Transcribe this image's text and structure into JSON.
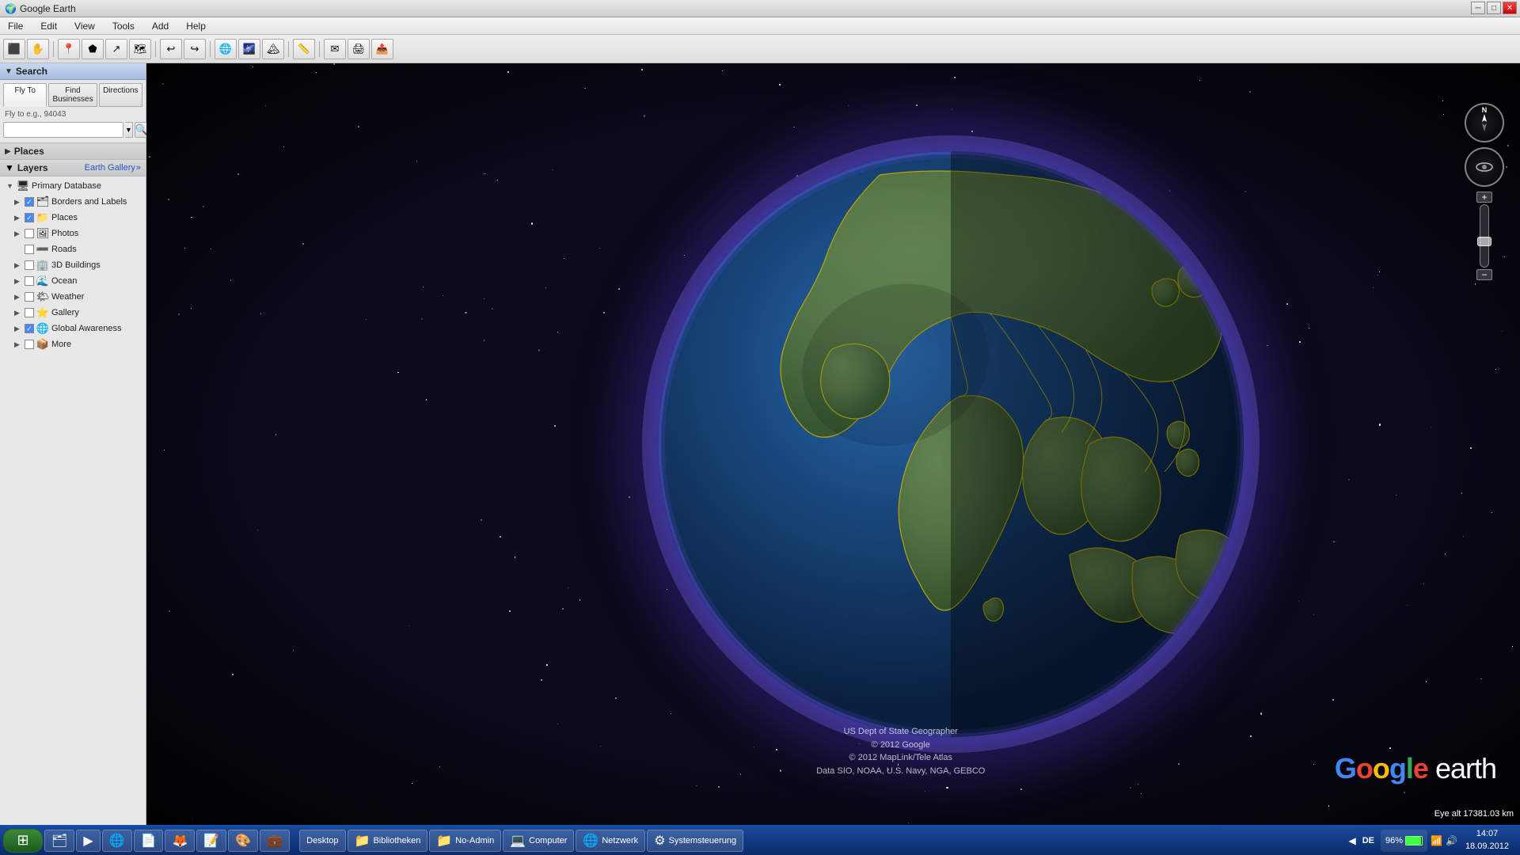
{
  "titlebar": {
    "title": "Google Earth",
    "icon": "🌍",
    "min_label": "─",
    "max_label": "□",
    "close_label": "✕"
  },
  "menubar": {
    "items": [
      "File",
      "Edit",
      "View",
      "Tools",
      "Add",
      "Help"
    ]
  },
  "toolbar": {
    "buttons": [
      "🔲",
      "✋",
      "🔍",
      "🔍",
      "↩",
      "↪",
      "🌐",
      "🖼",
      "🗺",
      "📏",
      "✉",
      "📌",
      "📷"
    ]
  },
  "search": {
    "section_label": "Search",
    "tabs": [
      "Fly To",
      "Find Businesses",
      "Directions"
    ],
    "active_tab": "Fly To",
    "hint": "Fly to e.g., 94043",
    "placeholder": "",
    "go_icon": "🔍"
  },
  "places": {
    "section_label": "Places"
  },
  "layers": {
    "section_label": "Layers",
    "gallery_label": "Earth Gallery",
    "gallery_arrow": "»",
    "items": [
      {
        "id": "primary-db",
        "name": "Primary Database",
        "level": 0,
        "expandable": true,
        "has_cb": false,
        "checked": false,
        "icon": "🖥"
      },
      {
        "id": "borders",
        "name": "Borders and Labels",
        "level": 1,
        "expandable": true,
        "has_cb": true,
        "checked": true,
        "icon": "🗂"
      },
      {
        "id": "places",
        "name": "Places",
        "level": 1,
        "expandable": true,
        "has_cb": true,
        "checked": true,
        "icon": "📁"
      },
      {
        "id": "photos",
        "name": "Photos",
        "level": 1,
        "expandable": true,
        "has_cb": false,
        "checked": false,
        "icon": "🖼"
      },
      {
        "id": "roads",
        "name": "Roads",
        "level": 1,
        "expandable": false,
        "has_cb": false,
        "checked": false,
        "icon": "➖"
      },
      {
        "id": "3d-buildings",
        "name": "3D Buildings",
        "level": 1,
        "expandable": true,
        "has_cb": false,
        "checked": false,
        "icon": "🏢"
      },
      {
        "id": "ocean",
        "name": "Ocean",
        "level": 1,
        "expandable": true,
        "has_cb": false,
        "checked": false,
        "icon": "🌊"
      },
      {
        "id": "weather",
        "name": "Weather",
        "level": 1,
        "expandable": true,
        "has_cb": false,
        "checked": false,
        "icon": "🌤"
      },
      {
        "id": "gallery",
        "name": "Gallery",
        "level": 1,
        "expandable": true,
        "has_cb": false,
        "checked": false,
        "icon": "⭐"
      },
      {
        "id": "global-awareness",
        "name": "Global Awareness",
        "level": 1,
        "expandable": true,
        "has_cb": true,
        "checked": true,
        "icon": "🌐"
      },
      {
        "id": "more",
        "name": "More",
        "level": 1,
        "expandable": true,
        "has_cb": false,
        "checked": false,
        "icon": "📦"
      }
    ]
  },
  "attribution": {
    "line1": "US Dept of State Geographer",
    "line2": "© 2012 Google",
    "line3": "© 2012 MapLink/Tele Atlas",
    "line4": "Data SIO, NOAA, U.S. Navy, NGA, GEBCO"
  },
  "logo": {
    "google_text": "Google",
    "earth_text": "earth"
  },
  "eye_alt": {
    "label": "Eye alt 17381.03 km"
  },
  "compass": {
    "north_label": "N"
  },
  "taskbar": {
    "start_icon": "⊞",
    "items": [
      {
        "icon": "🗂",
        "label": ""
      },
      {
        "icon": "▶",
        "label": ""
      },
      {
        "icon": "🌐",
        "label": ""
      },
      {
        "icon": "📄",
        "label": ""
      },
      {
        "icon": "🦊",
        "label": ""
      },
      {
        "icon": "📝",
        "label": ""
      },
      {
        "icon": "🎨",
        "label": ""
      },
      {
        "icon": "💼",
        "label": ""
      }
    ],
    "middle_items": [
      {
        "label": "Desktop"
      },
      {
        "icon": "📁",
        "label": "Bibliotheken"
      },
      {
        "icon": "📁",
        "label": "No-Admin"
      },
      {
        "icon": "💻",
        "label": "Computer"
      },
      {
        "icon": "🌐",
        "label": "Netzwerk"
      },
      {
        "icon": "⚙",
        "label": "Systemsteuerung"
      }
    ],
    "lang": "DE",
    "battery_percent": "96%",
    "time": "14:07",
    "date": "18.09.2012"
  }
}
